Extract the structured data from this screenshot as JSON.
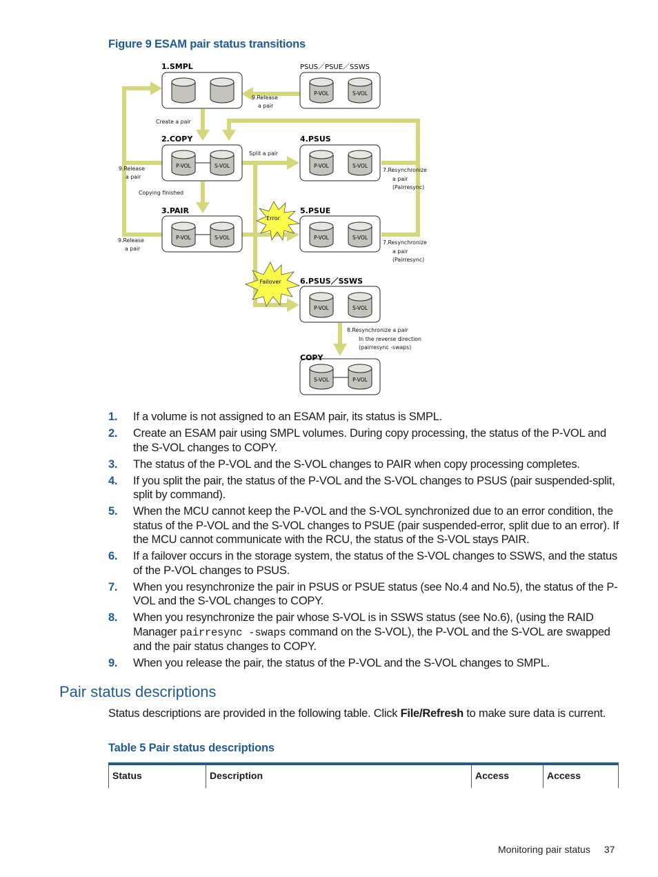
{
  "figure": {
    "caption": "Figure 9 ESAM pair status transitions",
    "states": {
      "smpl": "1.SMPL",
      "psus_psue_ssws": "PSUS／PSUE／SSWS",
      "copy": "2.COPY",
      "psus": "4.PSUS",
      "pair": "3.PAIR",
      "psue": "5.PSUE",
      "psus_ssws": "6.PSUS／SSWS",
      "copy_swapped": "COPY"
    },
    "volume_labels": {
      "pvol": "P-VOL",
      "svol": "S-VOL"
    },
    "transitions": {
      "release_top_1": "9.Release",
      "release_top_2": "a pair",
      "create": "Create a pair",
      "split": "Split a pair",
      "release_copy_1": "9.Release",
      "release_copy_2": "a pair",
      "copying_finished": "Copying finished",
      "release_pair_1": "9.Release",
      "release_pair_2": "a pair",
      "resync_psus_1": "7.Resynchronize",
      "resync_psus_2": "a pair",
      "resync_psus_3": "(Pairresync)",
      "resync_psue_1": "7.Resynchronize",
      "resync_psue_2": "a pair",
      "resync_psue_3": "(Pairresync)",
      "reverse_1": "8.Resynchronize a pair",
      "reverse_2": "In the reverse direction",
      "reverse_3": "(pairresync -swaps)"
    },
    "events": {
      "error": "Error",
      "failover": "Failover"
    },
    "colors": {
      "arrow": "#d6d67a",
      "starburst": "#fbfb4a",
      "cylinder": "#c4c4bc",
      "cylinder_top": "#e6e6e0"
    }
  },
  "steps": [
    {
      "num": "1.",
      "text": "If a volume is not assigned to an ESAM pair, its status is SMPL."
    },
    {
      "num": "2.",
      "text": "Create an ESAM pair using SMPL volumes. During copy processing, the status of the P-VOL and the S-VOL changes to COPY."
    },
    {
      "num": "3.",
      "text": "The status of the P-VOL and the S-VOL changes to PAIR when copy processing completes."
    },
    {
      "num": "4.",
      "text": "If you split the pair, the status of the P-VOL and the S-VOL changes to PSUS (pair suspended-split, split by command)."
    },
    {
      "num": "5.",
      "text": "When the MCU cannot keep the P-VOL and the S-VOL synchronized due to an error condition, the status of the P-VOL and the S-VOL changes to PSUE (pair suspended-error, split due to an error). If the MCU cannot communicate with the RCU, the status of the S-VOL stays PAIR."
    },
    {
      "num": "6.",
      "text": "If a failover occurs in the storage system, the status of the S-VOL changes to SSWS, and the status of the P-VOL changes to PSUS."
    },
    {
      "num": "7.",
      "text": "When you resynchronize the pair in PSUS or PSUE status (see No.4 and No.5), the status of the P-VOL and the S-VOL changes to COPY."
    },
    {
      "num": "8.",
      "text_before": "When you resynchronize the pair whose S-VOL is in SSWS status (see No.6), (using the RAID Manager ",
      "code": "pairresync -swaps",
      "text_after": " command on the S-VOL), the P-VOL and the S-VOL are swapped and the pair status changes to COPY."
    },
    {
      "num": "9.",
      "text": "When you release the pair, the status of the P-VOL and the S-VOL changes to SMPL."
    }
  ],
  "section": {
    "title": "Pair status descriptions",
    "intro_before": "Status descriptions are provided in the following table. Click ",
    "intro_bold": "File/Refresh",
    "intro_after": " to make sure data is current."
  },
  "table": {
    "caption": "Table 5 Pair status descriptions",
    "headers": [
      "Status",
      "Description",
      "Access",
      "Access"
    ]
  },
  "footer": {
    "section": "Monitoring pair status",
    "page": "37"
  },
  "colors": {
    "heading_blue": "#1f5a96"
  }
}
